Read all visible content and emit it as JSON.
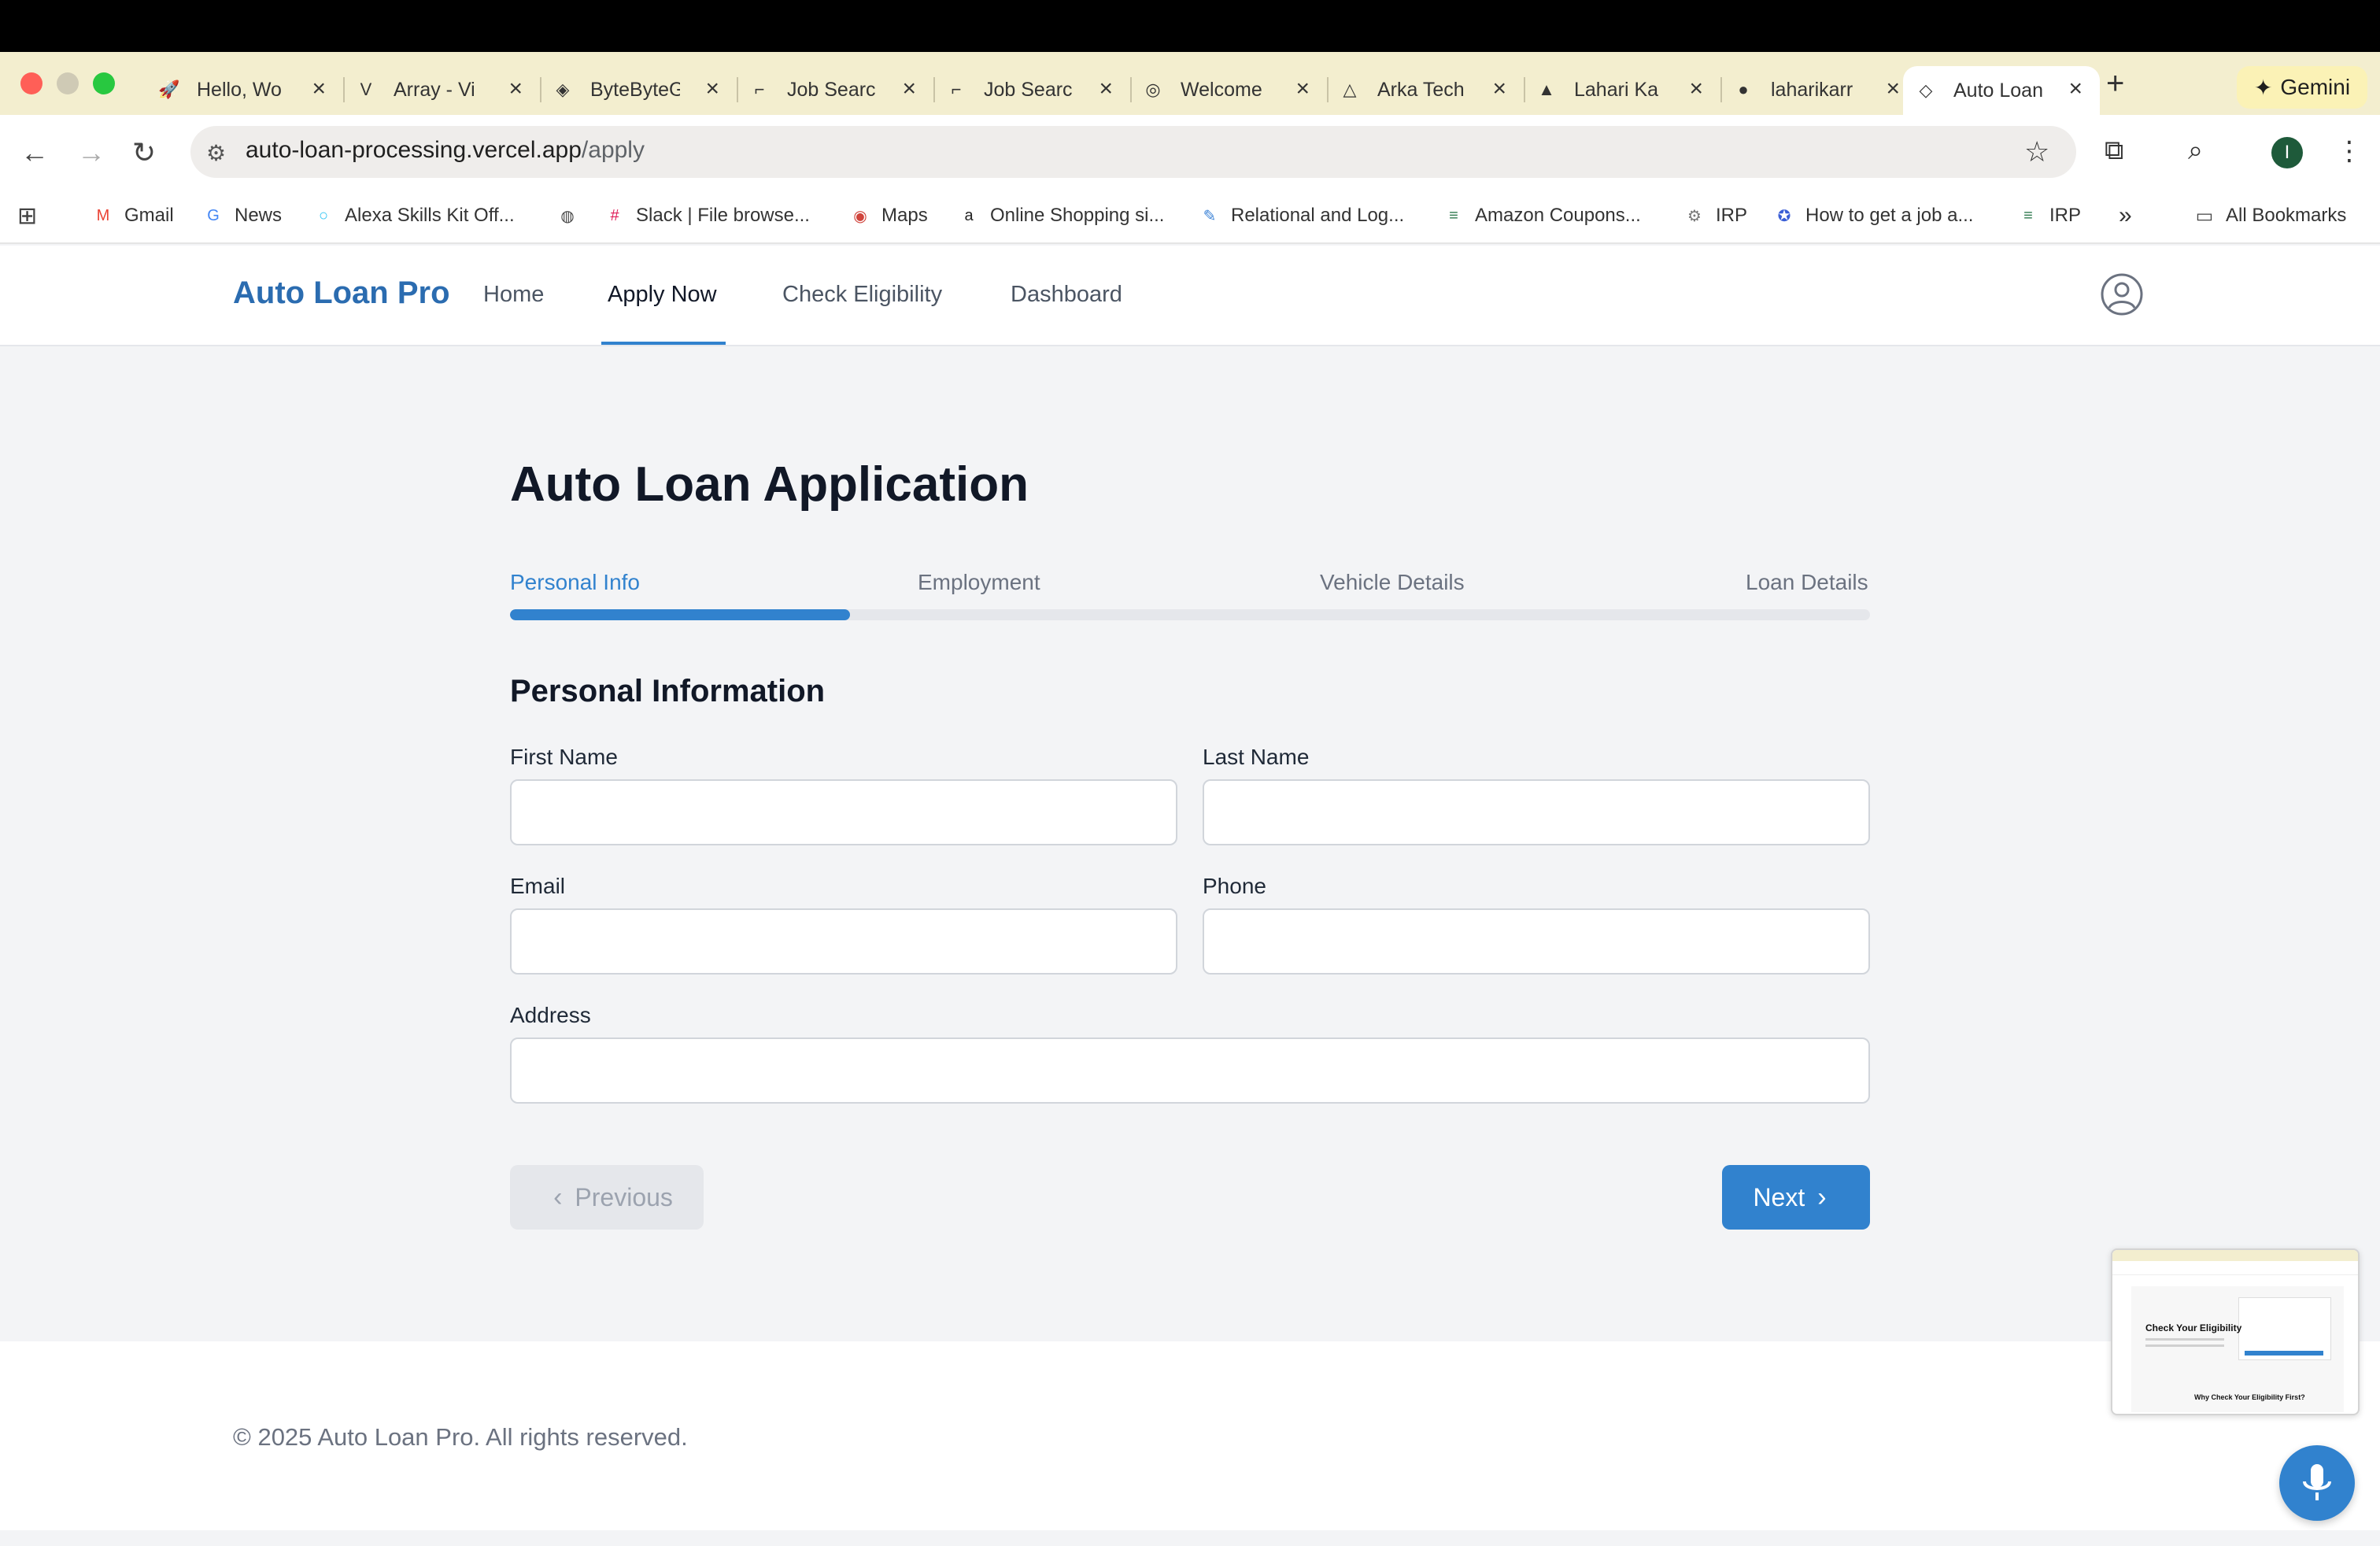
{
  "browser": {
    "tabs": [
      {
        "title": "Hello, Wo",
        "icon": "rocket-icon",
        "glyph": "🚀",
        "active": false
      },
      {
        "title": "Array - Vi",
        "icon": "va-logo-icon",
        "glyph": "V",
        "active": false
      },
      {
        "title": "ByteByteG",
        "icon": "bytebytego-icon",
        "glyph": "◈",
        "active": false
      },
      {
        "title": "Job Searc",
        "icon": "job-search-icon",
        "glyph": "⌐",
        "active": false
      },
      {
        "title": "Job Searc",
        "icon": "job-search-icon",
        "glyph": "⌐",
        "active": false
      },
      {
        "title": "Welcome",
        "icon": "welcome-icon",
        "glyph": "◎",
        "active": false
      },
      {
        "title": "Arka Tech",
        "icon": "arka-icon",
        "glyph": "△",
        "active": false
      },
      {
        "title": "Lahari Ka",
        "icon": "vercel-icon",
        "glyph": "▲",
        "active": false
      },
      {
        "title": "laharikarr",
        "icon": "github-icon",
        "glyph": "●",
        "active": false
      },
      {
        "title": "Auto Loan",
        "icon": "layers-icon",
        "glyph": "◇",
        "active": true
      }
    ],
    "gemini_label": "Gemini",
    "url_host": "auto-loan-processing.vercel.app",
    "url_path": "/apply",
    "profile_initial": "I",
    "bookmarks": [
      {
        "label": "Gmail",
        "icon": "gmail-icon",
        "glyph": "M",
        "color": "#ea4335"
      },
      {
        "label": "News",
        "icon": "news-icon",
        "glyph": "G",
        "color": "#4285f4"
      },
      {
        "label": "Alexa Skills Kit Off...",
        "icon": "alexa-icon",
        "glyph": "○",
        "color": "#31c4f3"
      },
      {
        "label": "",
        "icon": "globe-icon",
        "glyph": "◍",
        "color": "#444444"
      },
      {
        "label": "Slack | File browse...",
        "icon": "slack-icon",
        "glyph": "#",
        "color": "#e01e5a"
      },
      {
        "label": "Maps",
        "icon": "maps-icon",
        "glyph": "◉",
        "color": "#d0443c"
      },
      {
        "label": "Online Shopping si...",
        "icon": "amazon-icon",
        "glyph": "a",
        "color": "#222222"
      },
      {
        "label": "Relational and Log...",
        "icon": "relational-icon",
        "glyph": "✎",
        "color": "#3b82d6"
      },
      {
        "label": "Amazon Coupons...",
        "icon": "coupons-icon",
        "glyph": "≡",
        "color": "#2f7a4f"
      },
      {
        "label": "IRP",
        "icon": "irp-gear-icon",
        "glyph": "⚙",
        "color": "#777777"
      },
      {
        "label": "How to get a job a...",
        "icon": "howto-icon",
        "glyph": "✪",
        "color": "#3b5fd6"
      },
      {
        "label": "IRP",
        "icon": "irp-icon",
        "glyph": "≡",
        "color": "#2f7a4f"
      }
    ],
    "all_bookmarks_label": "All Bookmarks"
  },
  "app": {
    "brand": "Auto Loan Pro",
    "nav": [
      "Home",
      "Apply Now",
      "Check Eligibility",
      "Dashboard"
    ],
    "active_nav": "Apply Now"
  },
  "form": {
    "title": "Auto Loan Application",
    "steps": [
      "Personal Info",
      "Employment",
      "Vehicle Details",
      "Loan Details"
    ],
    "current_step": 1,
    "progress_fraction": 0.25,
    "section_title": "Personal Information",
    "fields": {
      "first_name": {
        "label": "First Name",
        "value": ""
      },
      "last_name": {
        "label": "Last Name",
        "value": ""
      },
      "email": {
        "label": "Email",
        "value": ""
      },
      "phone": {
        "label": "Phone",
        "value": ""
      },
      "address": {
        "label": "Address",
        "value": ""
      }
    },
    "previous_label": "Previous",
    "next_label": "Next"
  },
  "footer": {
    "copyright": "© 2025 Auto Loan Pro. All rights reserved."
  },
  "preview": {
    "title": "Check Your Eligibility",
    "subtitle": "Why Check Your Eligibility First?"
  },
  "colors": {
    "accent": "#3182ce",
    "brand": "#2b6cb0",
    "page_bg": "#f3f4f6"
  }
}
